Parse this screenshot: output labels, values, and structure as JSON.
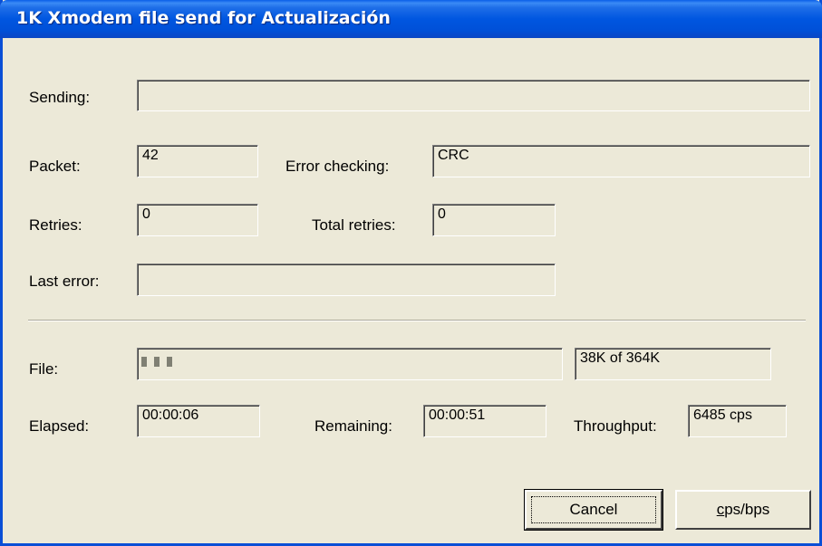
{
  "window": {
    "title": "1K Xmodem file send for Actualización"
  },
  "status": {
    "sending_label": "Sending:",
    "sending_value": "",
    "packet_label": "Packet:",
    "packet_value": "42",
    "error_checking_label": "Error checking:",
    "error_checking_value": "CRC",
    "retries_label": "Retries:",
    "retries_value": "0",
    "total_retries_label": "Total retries:",
    "total_retries_value": "0",
    "last_error_label": "Last error:",
    "last_error_value": ""
  },
  "transfer": {
    "file_label": "File:",
    "file_progress_fraction": 0.104,
    "file_size_text": "38K of 364K",
    "elapsed_label": "Elapsed:",
    "elapsed_value": "00:00:06",
    "remaining_label": "Remaining:",
    "remaining_value": "00:00:51",
    "throughput_label": "Throughput:",
    "throughput_value": "6485 cps"
  },
  "buttons": {
    "cancel_label": "Cancel",
    "cps_bps_prefix": "c",
    "cps_bps_rest": "ps/bps"
  },
  "colors": {
    "titlebar": "#0054e3",
    "window_bg": "#ece9d8",
    "progress_block": "#808074"
  }
}
